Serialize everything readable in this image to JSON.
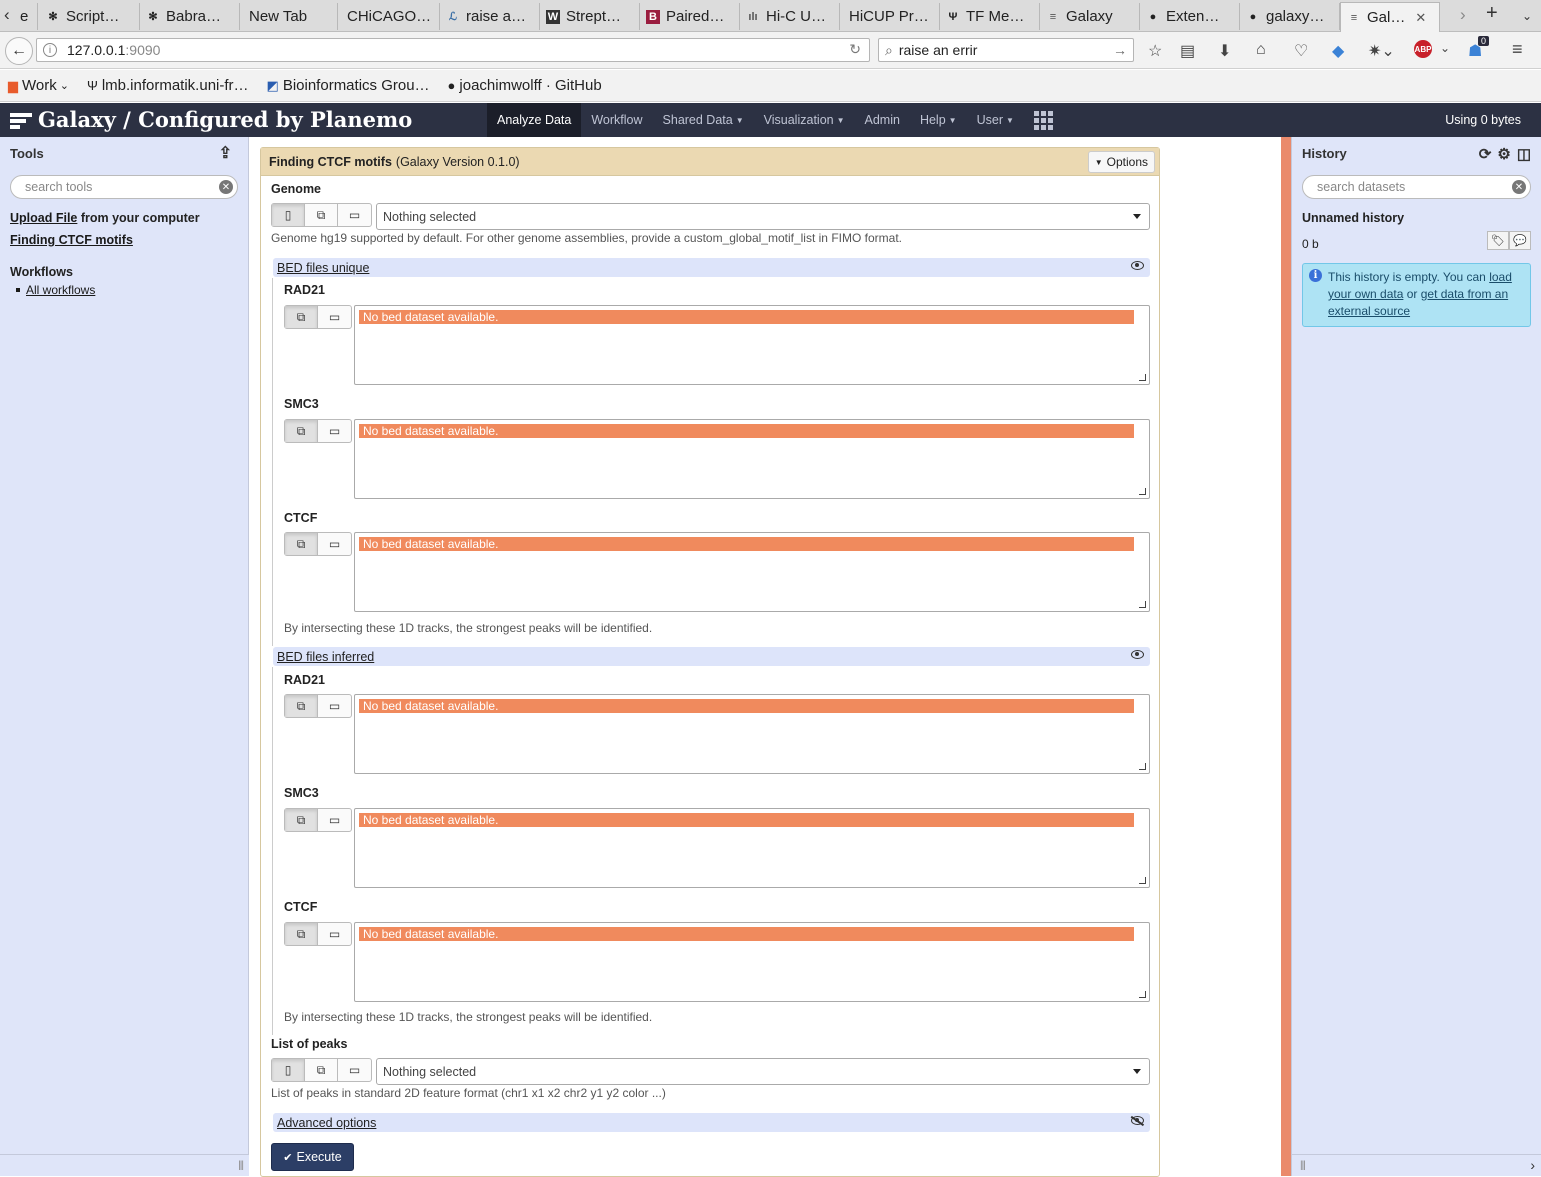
{
  "browser": {
    "tabs": [
      {
        "label": "e",
        "icon": "page-icon"
      },
      {
        "label": "Script…",
        "icon": "puzzle-icon"
      },
      {
        "label": "Babra…",
        "icon": "puzzle-icon"
      },
      {
        "label": "New Tab",
        "icon": ""
      },
      {
        "label": "CHiCAGO…",
        "icon": ""
      },
      {
        "label": "raise a…",
        "icon": "python-icon"
      },
      {
        "label": "Strept…",
        "icon": "wikipedia-icon"
      },
      {
        "label": "Paired…",
        "icon": "b-icon"
      },
      {
        "label": "Hi-C U…",
        "icon": "chart-icon"
      },
      {
        "label": "HiCUP Pr…",
        "icon": ""
      },
      {
        "label": "TF Me…",
        "icon": "fork-icon"
      },
      {
        "label": "Galaxy",
        "icon": "galaxy-icon"
      },
      {
        "label": "Exten…",
        "icon": "github-icon"
      },
      {
        "label": "galaxy…",
        "icon": "github-icon"
      },
      {
        "label": "Gal…",
        "icon": "galaxy-icon"
      }
    ],
    "url_host": "127.0.0.1",
    "url_port": ":9090",
    "search_value": "raise an errir",
    "bookmarks": [
      {
        "label": "Work",
        "icon": "folder-icon"
      },
      {
        "label": "lmb.informatik.uni-fr…",
        "icon": "fork-icon"
      },
      {
        "label": "Bioinformatics Grou…",
        "icon": "bookmark-icon"
      },
      {
        "label": "joachimwolff · GitHub",
        "icon": "github-icon"
      }
    ],
    "notification_count": "0"
  },
  "masthead": {
    "brand": "Galaxy / Configured by Planemo",
    "menu": [
      "Analyze Data",
      "Workflow",
      "Shared Data",
      "Visualization",
      "Admin",
      "Help",
      "User"
    ],
    "quota": "Using 0 bytes"
  },
  "tools_panel": {
    "title": "Tools",
    "search_placeholder": "search tools",
    "upload_link": "Upload File",
    "upload_suffix": " from your computer",
    "tool_link": "Finding CTCF motifs",
    "workflows_title": "Workflows",
    "all_workflows": "All workflows"
  },
  "form": {
    "tool_name": "Finding CTCF motifs",
    "tool_version": "(Galaxy Version 0.1.0)",
    "options_label": "Options",
    "genome_label": "Genome",
    "genome_value": "Nothing selected",
    "genome_help": "Genome hg19 supported by default. For other genome assemblies, provide a custom_global_motif_list in FIMO format.",
    "section_unique": "BED files unique",
    "section_inferred": "BED files inferred",
    "rad21": "RAD21",
    "smc3": "SMC3",
    "ctcf": "CTCF",
    "no_dataset": "No bed dataset available.",
    "intersect_help": "By intersecting these 1D tracks, the strongest peaks will be identified.",
    "peaks_label": "List of peaks",
    "peaks_value": "Nothing selected",
    "peaks_help": "List of peaks in standard 2D feature format (chr1 x1 x2 chr2 y1 y2 color ...)",
    "advanced": "Advanced options",
    "execute": "Execute"
  },
  "history_panel": {
    "title": "History",
    "search_placeholder": "search datasets",
    "name": "Unnamed history",
    "size": "0 b",
    "empty_msg_1": "This history is empty. You can ",
    "load_link": "load your own data",
    "or": " or ",
    "get_link": "get data from an external source"
  },
  "colors": {
    "masthead": "#2c3143",
    "panel_bg": "#dfe5f9",
    "warning": "#f08a5d",
    "form_header": "#ebd9b2",
    "info": "#aee3f4"
  }
}
